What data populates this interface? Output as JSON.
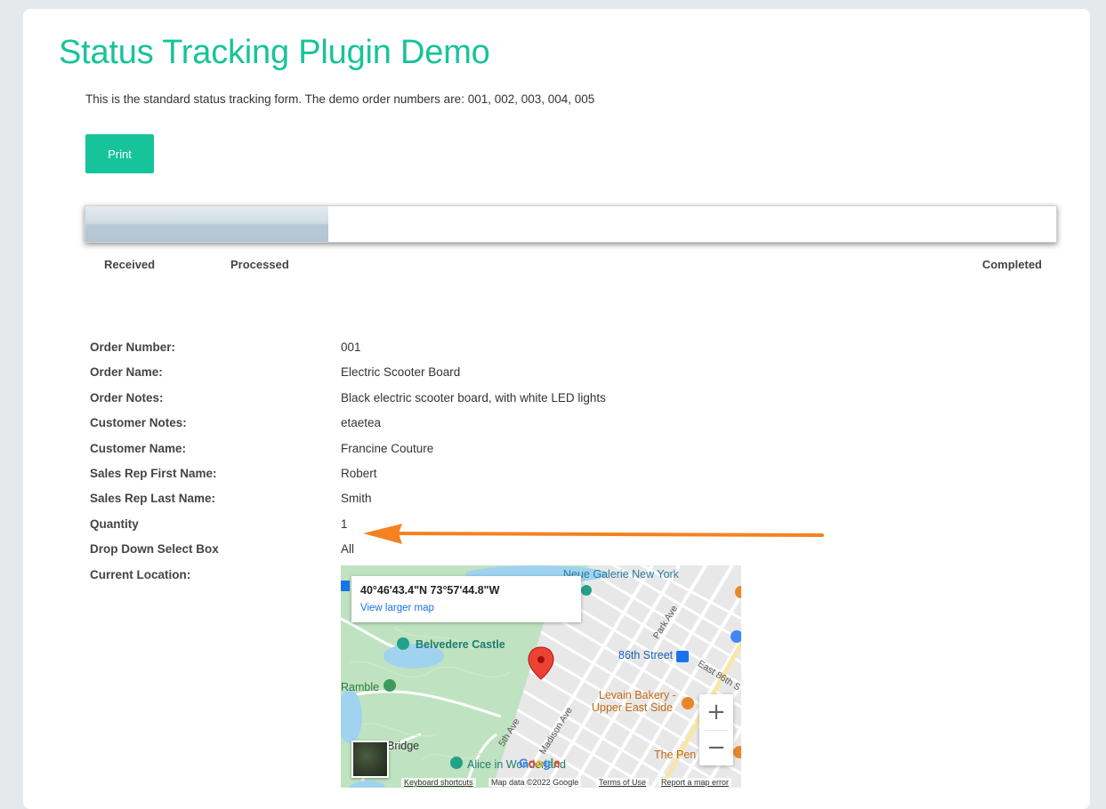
{
  "page": {
    "title": "Status Tracking Plugin Demo",
    "intro": "This is the standard status tracking form. The demo order numbers are: 001, 002, 003, 004, 005",
    "print_label": "Print",
    "accent_color": "#17c39a"
  },
  "progress": {
    "fraction": 0.25,
    "stages": [
      "Received",
      "Processed",
      "Completed"
    ]
  },
  "details": [
    {
      "label": "Order Number:",
      "value": "001"
    },
    {
      "label": "Order Name:",
      "value": "Electric Scooter Board"
    },
    {
      "label": "Order Notes:",
      "value": "Black electric scooter board, with white LED lights"
    },
    {
      "label": "Customer Notes:",
      "value": "etaetea"
    },
    {
      "label": "Customer Name:",
      "value": "Francine Couture"
    },
    {
      "label": "Sales Rep First Name:",
      "value": "Robert"
    },
    {
      "label": "Sales Rep Last Name:",
      "value": "Smith"
    },
    {
      "label": "Quantity",
      "value": "1"
    },
    {
      "label": "Drop Down Select Box",
      "value": "All"
    },
    {
      "label": "Current Location:",
      "value": ""
    }
  ],
  "map": {
    "coords": "40°46'43.4\"N 73°57'44.8\"W",
    "view_larger": "View larger map",
    "places": {
      "neue_galerie": "Neue Galerie New York",
      "belvedere": "Belvedere Castle",
      "station_86": "86th Street",
      "park_ave": "Park Ave",
      "east_86": "East 86th S",
      "ramble": "Ramble",
      "levain": "Levain Bakery -",
      "levain2": "Upper East Side",
      "fifth_ave": "5th Ave",
      "madison_ave": "Madison Ave",
      "bridge": "Bridge",
      "alice": "Alice in Wonderland",
      "the_pen": "The Pen"
    },
    "zoom_in": "+",
    "zoom_out": "−",
    "google": "Google",
    "attribution": {
      "shortcuts": "Keyboard shortcuts",
      "data": "Map data ©2022 Google",
      "terms": "Terms of Use",
      "report": "Report a map error"
    }
  }
}
